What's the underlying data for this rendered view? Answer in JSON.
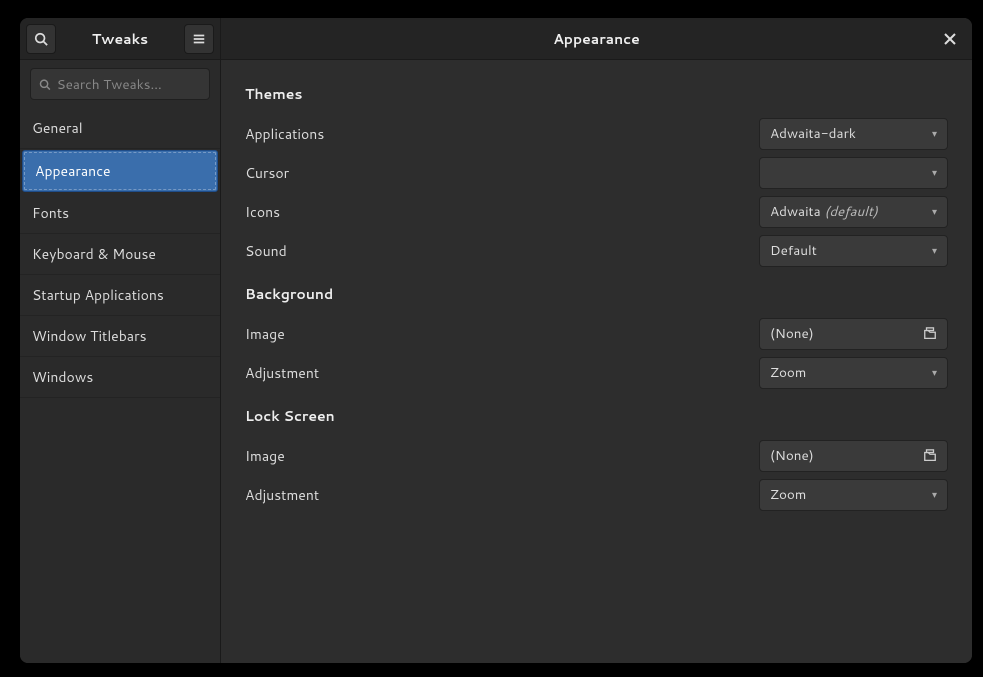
{
  "header": {
    "app_title": "Tweaks",
    "page_title": "Appearance"
  },
  "search": {
    "placeholder": "Search Tweaks…"
  },
  "sidebar": {
    "items": [
      {
        "label": "General",
        "active": false
      },
      {
        "label": "Appearance",
        "active": true
      },
      {
        "label": "Fonts",
        "active": false
      },
      {
        "label": "Keyboard & Mouse",
        "active": false
      },
      {
        "label": "Startup Applications",
        "active": false
      },
      {
        "label": "Window Titlebars",
        "active": false
      },
      {
        "label": "Windows",
        "active": false
      }
    ]
  },
  "sections": {
    "themes": {
      "title": "Themes",
      "applications": {
        "label": "Applications",
        "value": "Adwaita-dark"
      },
      "cursor": {
        "label": "Cursor",
        "value": ""
      },
      "icons": {
        "label": "Icons",
        "value": "Adwaita",
        "suffix": "(default)"
      },
      "sound": {
        "label": "Sound",
        "value": "Default"
      }
    },
    "background": {
      "title": "Background",
      "image": {
        "label": "Image",
        "value": "(None)"
      },
      "adjustment": {
        "label": "Adjustment",
        "value": "Zoom"
      }
    },
    "lockscreen": {
      "title": "Lock Screen",
      "image": {
        "label": "Image",
        "value": "(None)"
      },
      "adjustment": {
        "label": "Adjustment",
        "value": "Zoom"
      }
    }
  }
}
